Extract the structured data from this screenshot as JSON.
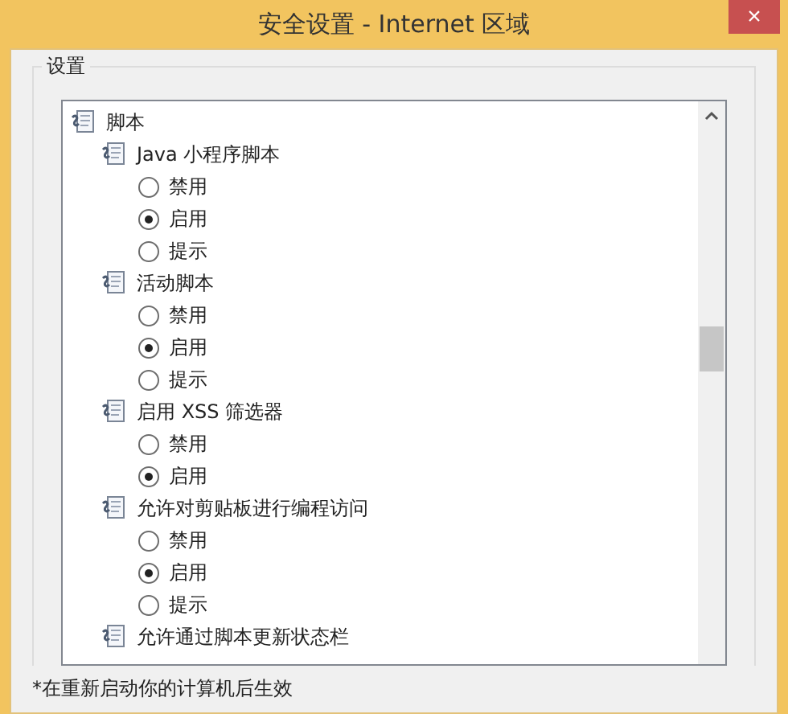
{
  "window": {
    "title": "安全设置 - Internet 区域",
    "close": "×"
  },
  "group": {
    "label": "设置"
  },
  "tree": [
    {
      "label": "脚本",
      "children": [
        {
          "label": "Java 小程序脚本",
          "options": [
            {
              "label": "禁用",
              "selected": false
            },
            {
              "label": "启用",
              "selected": true
            },
            {
              "label": "提示",
              "selected": false
            }
          ]
        },
        {
          "label": "活动脚本",
          "options": [
            {
              "label": "禁用",
              "selected": false
            },
            {
              "label": "启用",
              "selected": true
            },
            {
              "label": "提示",
              "selected": false
            }
          ]
        },
        {
          "label": "启用 XSS 筛选器",
          "options": [
            {
              "label": "禁用",
              "selected": false
            },
            {
              "label": "启用",
              "selected": true
            }
          ]
        },
        {
          "label": "允许对剪贴板进行编程访问",
          "options": [
            {
              "label": "禁用",
              "selected": false
            },
            {
              "label": "启用",
              "selected": true
            },
            {
              "label": "提示",
              "selected": false
            }
          ]
        },
        {
          "label": "允许通过脚本更新状态栏"
        }
      ]
    }
  ],
  "note": "*在重新启动你的计算机后生效"
}
